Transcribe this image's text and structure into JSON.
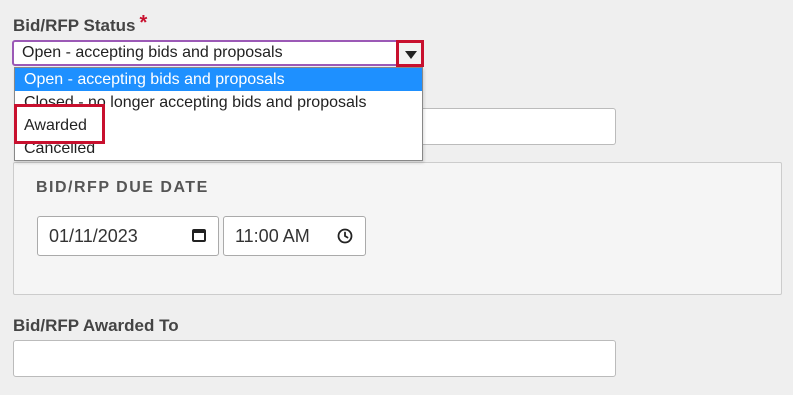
{
  "status_field": {
    "label": "Bid/RFP Status",
    "required_marker": "*",
    "selected_value": "Open - accepting bids and proposals",
    "options": [
      "Open - accepting bids and proposals",
      "Closed - no longer accepting bids and proposals",
      "Awarded",
      "Cancelled"
    ],
    "highlighted_option": "Awarded"
  },
  "due_date": {
    "title": "BID/RFP DUE DATE",
    "date_value": "01/11/2023",
    "time_value": "11:00 AM"
  },
  "awarded_to": {
    "label": "Bid/RFP Awarded To",
    "value": ""
  },
  "icons": {
    "dropdown_arrow": "caret-down-icon",
    "calendar": "calendar-icon",
    "clock": "clock-icon"
  },
  "colors": {
    "highlight_border": "#c8102e",
    "selected_option_bg": "#1e90ff",
    "select_focus_border": "#9b59b6"
  }
}
